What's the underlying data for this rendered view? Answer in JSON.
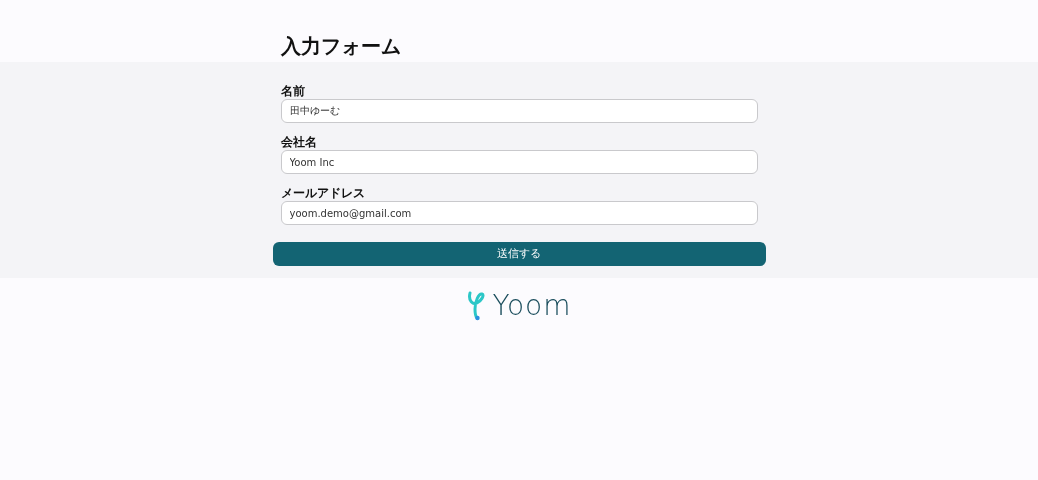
{
  "title": "入力フォーム",
  "fields": [
    {
      "label": "名前",
      "value": "田中ゆーむ"
    },
    {
      "label": "会社名",
      "value": "Yoom Inc"
    },
    {
      "label": "メールアドレス",
      "value": "yoom.demo@gmail.com"
    }
  ],
  "submit_button": "送信する",
  "footer": {
    "logo_text": "Yoom"
  }
}
